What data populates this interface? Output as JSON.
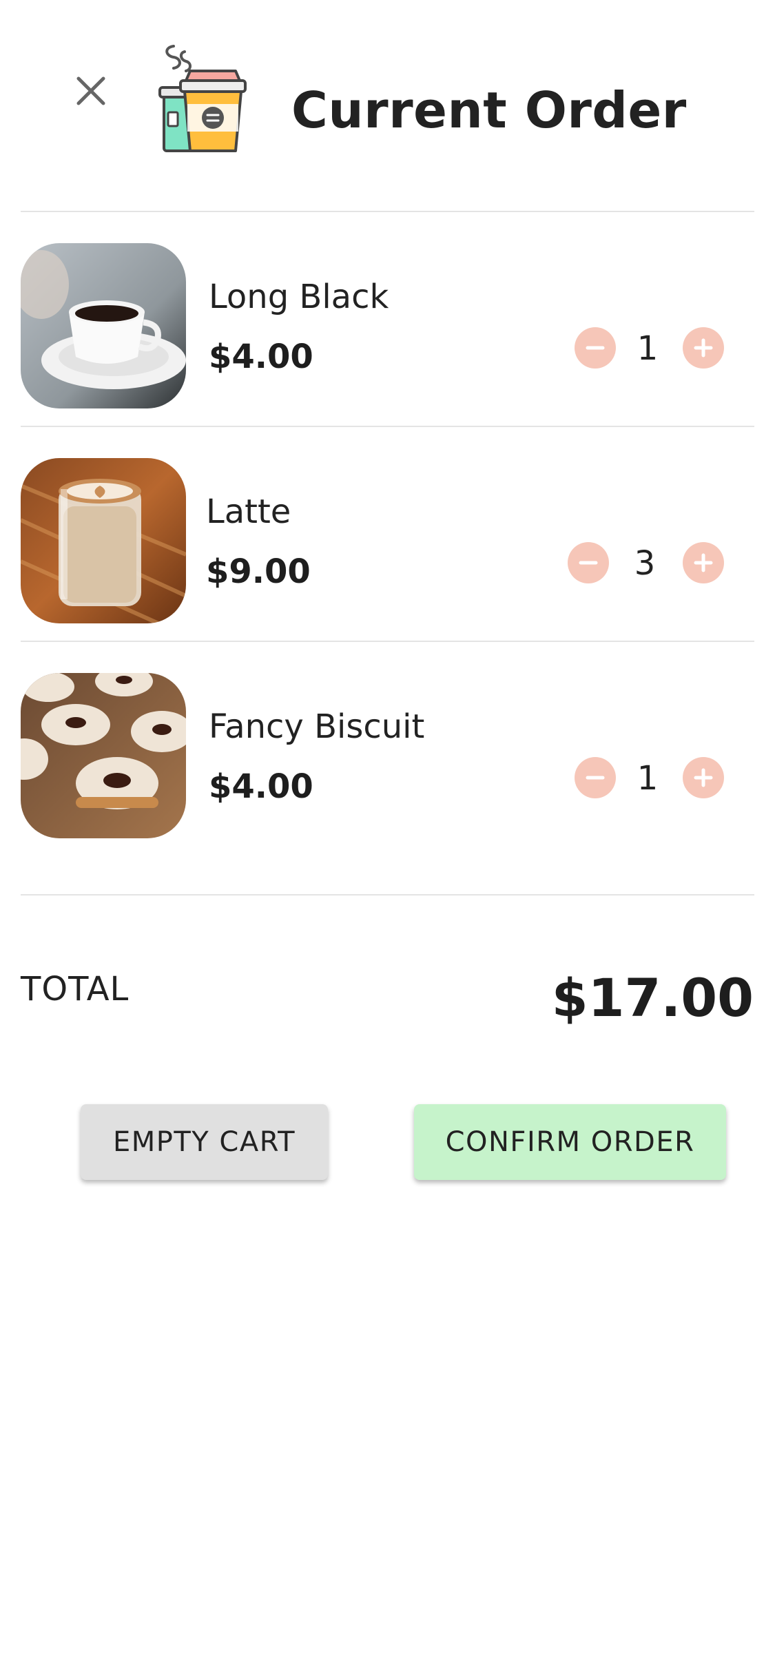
{
  "header": {
    "close_icon": "close-icon",
    "logo_icon": "coffee-cups-icon",
    "title": "Current Order"
  },
  "items": [
    {
      "name": "Long Black",
      "price": "$4.00",
      "quantity": "1",
      "image": "long-black-coffee-photo"
    },
    {
      "name": "Latte",
      "price": "$9.00",
      "quantity": "3",
      "image": "latte-art-photo"
    },
    {
      "name": "Fancy Biscuit",
      "price": "$4.00",
      "quantity": "1",
      "image": "jam-biscuits-photo"
    }
  ],
  "quantity_controls": {
    "decrement_icon": "minus-icon",
    "increment_icon": "plus-icon",
    "button_color": "#f6c6b8"
  },
  "total": {
    "label": "TOTAL",
    "value": "$17.00"
  },
  "actions": {
    "empty_cart": "EMPTY CART",
    "confirm_order": "CONFIRM ORDER",
    "empty_color": "#e0e0e0",
    "confirm_color": "#c6f3cb"
  }
}
